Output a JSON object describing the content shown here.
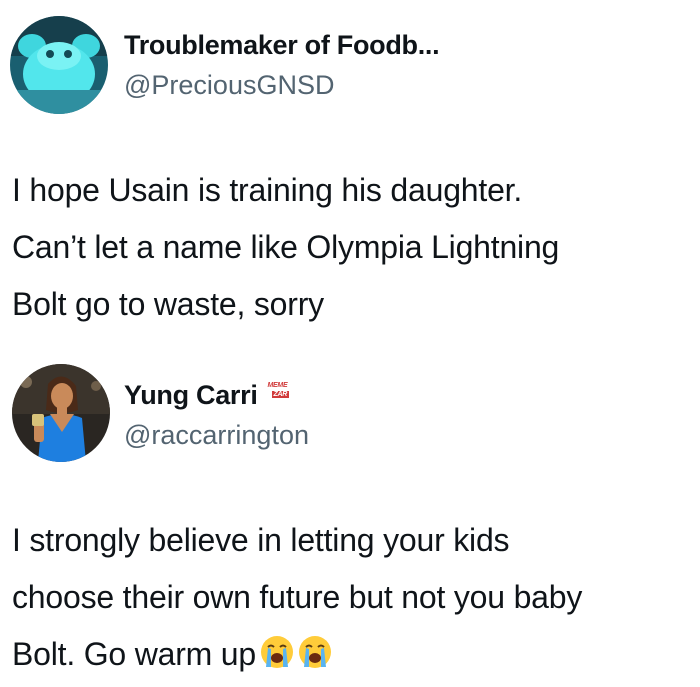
{
  "tweets": [
    {
      "display_name": "Troublemaker of Foodb...",
      "handle": "@PreciousGNSD",
      "avatar_icon": "cyan-character-avatar",
      "text_lines": [
        "I hope Usain is training his daughter.",
        "Can’t let a name like Olympia Lightning",
        "Bolt go to waste, sorry"
      ]
    },
    {
      "display_name": "Yung Carri",
      "handle": "@raccarrington",
      "avatar_icon": "woman-blue-dress-avatar",
      "watermark": {
        "line1": "MEME",
        "line2": "ZAR"
      },
      "text_lines": [
        "I strongly believe in letting your kids",
        "choose their own future but not you baby",
        "Bolt. Go warm up"
      ],
      "trailing_emojis": [
        "loudly-crying-face-emoji",
        "loudly-crying-face-emoji"
      ]
    }
  ],
  "colors": {
    "text": "#0f1419",
    "handle": "#536471",
    "background": "#ffffff",
    "avatar1_bg": "#1f6b7f",
    "avatar1_figure": "#4fe0e8",
    "avatar2_dress": "#1e7fe0"
  }
}
